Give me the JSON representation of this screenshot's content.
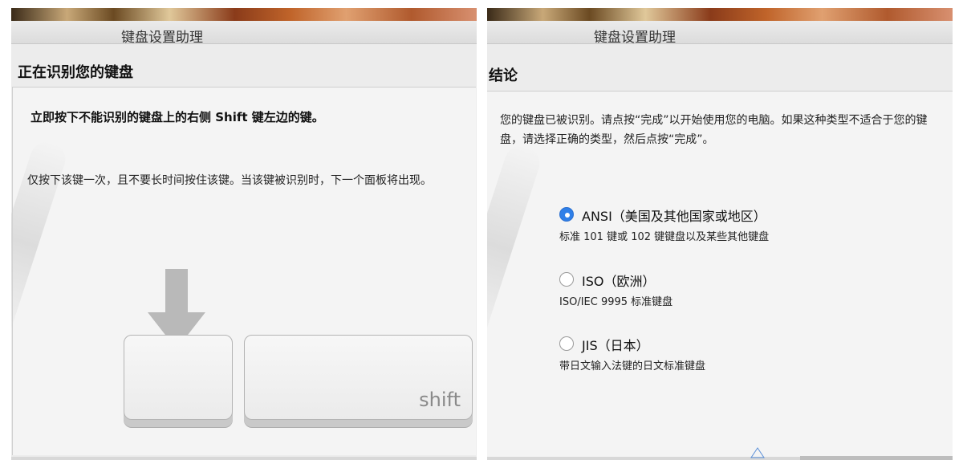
{
  "left_panel": {
    "window_title": "键盘设置助理",
    "heading": "正在识别您的键盘",
    "instruction_bold": "立即按下不能识别的键盘上的右侧 Shift 键左边的键。",
    "instruction_detail": "仅按下该键一次，且不要长时间按住该键。当该键被识别时，下一个面板将出现。",
    "shift_key_label": "shift"
  },
  "right_panel": {
    "window_title": "键盘设置助理",
    "heading": "结论",
    "result_text": "您的键盘已被识别。请点按“完成”以开始使用您的电脑。如果这种类型不适合于您的键盘，请选择正确的类型，然后点按“完成”。",
    "options": [
      {
        "label": "ANSI（美国及其他国家或地区）",
        "description": "标准 101 键或 102 键键盘以及某些其他键盘",
        "selected": true
      },
      {
        "label": "ISO（欧洲）",
        "description": "ISO/IEC 9995 标准键盘",
        "selected": false
      },
      {
        "label": "JIS（日本）",
        "description": "带日文输入法键的日文标准键盘",
        "selected": false
      }
    ]
  },
  "colors": {
    "accent": "#2f7fe8",
    "window_bg": "#ececec",
    "content_bg": "#f4f4f4"
  }
}
